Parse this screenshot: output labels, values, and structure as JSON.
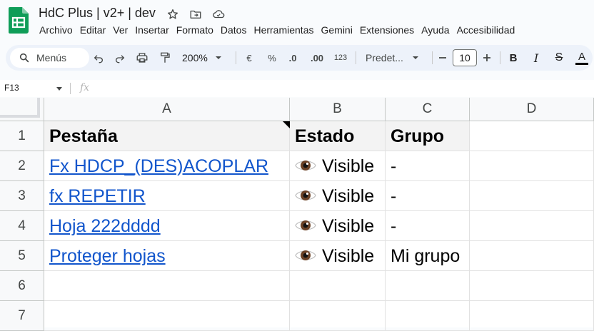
{
  "app": {
    "doc_title": "HdC Plus  | v2+ | dev",
    "icons": [
      "star-icon",
      "move-to-folder-icon",
      "cloud-status-icon"
    ],
    "brand_color": "#0f9d58"
  },
  "menu": [
    "Archivo",
    "Editar",
    "Ver",
    "Insertar",
    "Formato",
    "Datos",
    "Herramientas",
    "Gemini",
    "Extensiones",
    "Ayuda",
    "Accesibilidad"
  ],
  "toolbar": {
    "search_label": "Menús",
    "zoom": "200%",
    "currency": "€",
    "percent": "%",
    "decrease_decimals": ".0",
    "increase_decimals": ".00",
    "number_format": "123",
    "font": "Predet...",
    "font_size": "10",
    "bold": "B",
    "italic": "I",
    "strikethrough": "S",
    "text_color": "A"
  },
  "formula_bar": {
    "name_box": "F13",
    "fx": "fx",
    "value": ""
  },
  "sheet": {
    "columns": [
      "A",
      "B",
      "C",
      "D"
    ],
    "rows": [
      "1",
      "2",
      "3",
      "4",
      "5",
      "6",
      "7"
    ],
    "header": {
      "a": "Pestaña",
      "b": "Estado",
      "c": "Grupo"
    },
    "data": [
      {
        "a": "Fx HDCP_(DES)ACOPLAR",
        "b": "Visible",
        "c": "-"
      },
      {
        "a": "fx REPETIR",
        "b": "Visible",
        "c": "-"
      },
      {
        "a": "Hoja 222dddd",
        "b": "Visible",
        "c": "-"
      },
      {
        "a": "Proteger hojas",
        "b": "Visible",
        "c": "Mi grupo"
      }
    ],
    "link_color": "#1155cc",
    "header_bg": "#f3f3f3"
  }
}
